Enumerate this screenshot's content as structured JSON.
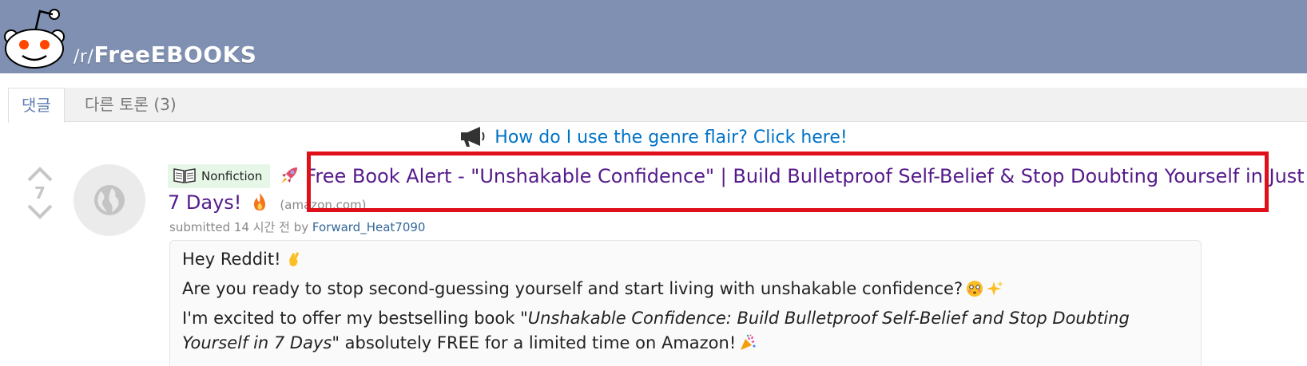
{
  "header": {
    "subreddit_prefix": "/r/",
    "subreddit_name": "FreeEBOOKS",
    "logo_icon": "reddit-snoo-icon",
    "background_color": "#7f90b2"
  },
  "tabs": [
    {
      "label": "댓글",
      "active": true
    },
    {
      "label": "다른 토론 (3)",
      "active": false
    }
  ],
  "announcement": {
    "icon": "megaphone-icon",
    "text": "How do I use the genre flair? Click here!",
    "link_color": "#0073c7"
  },
  "post": {
    "score": "7",
    "flair": "Nonfiction",
    "flair_icon": "open-book-icon",
    "title": "Free Book Alert - \"Unshakable Confidence\" | Build Bulletproof Self-Belief & Stop Doubting Yourself in Just 7 Days!",
    "title_color": "#551a8b",
    "domain": "(amazon.com)",
    "submitted_prefix": "submitted 14 시간 전 by",
    "author": "Forward_Heat7090",
    "body": {
      "line1": "Hey Reddit!",
      "line2": "Are you ready to stop second-guessing yourself and start living with unshakable confidence?",
      "line3_prefix": "I'm excited to offer my bestselling book ",
      "line3_book": "\"Unshakable Confidence: Build Bulletproof Self-Belief and Stop Doubting Yourself in 7 Days\"",
      "line3_suffix": " absolutely FREE for a limited time on Amazon!"
    }
  },
  "highlight_color": "#e0101a"
}
